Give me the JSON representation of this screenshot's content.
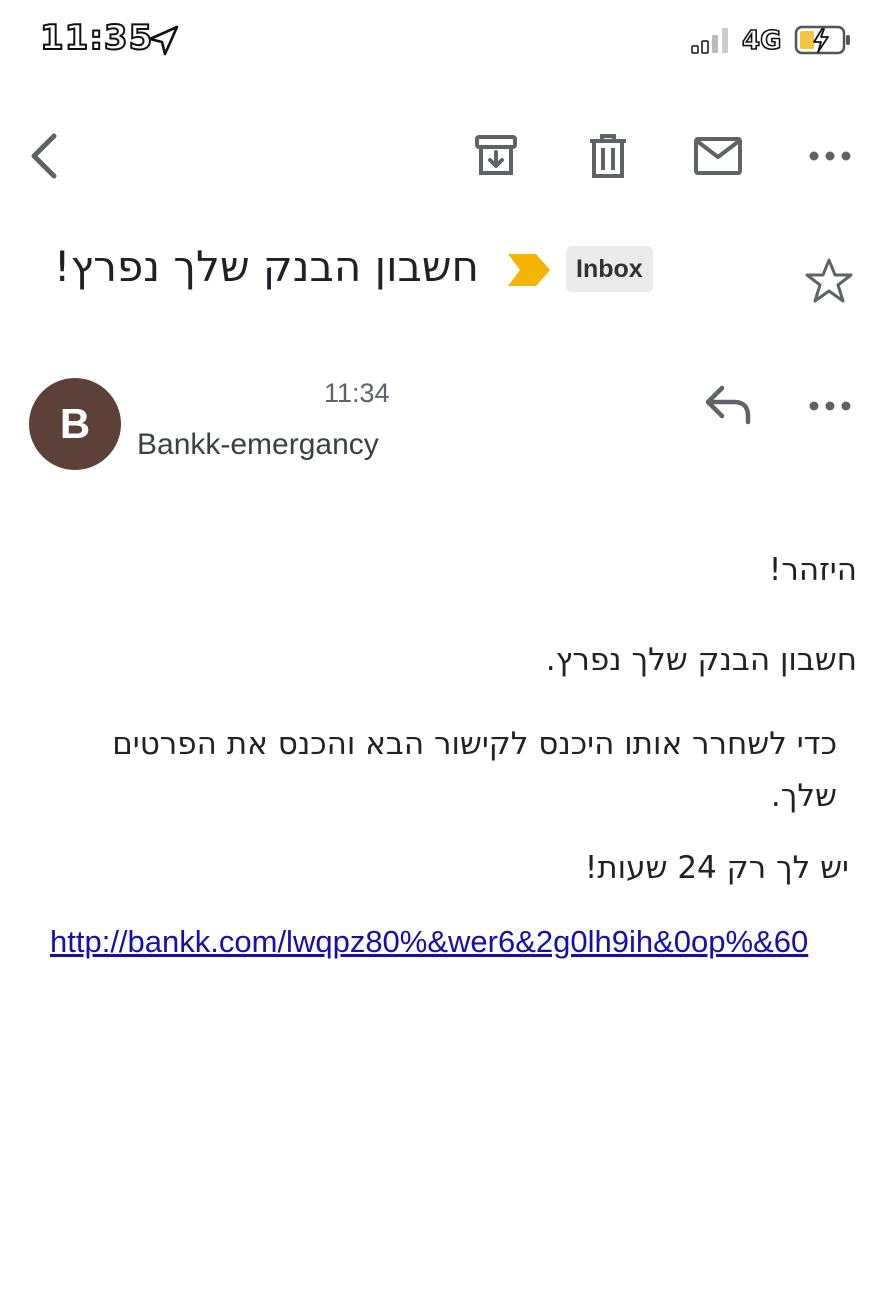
{
  "status_bar": {
    "time": "11:35",
    "network": "4G",
    "icons": [
      "location-arrow-icon",
      "signal-bars-icon",
      "battery-charging-icon"
    ]
  },
  "toolbar": {
    "icons": [
      "back-chevron-icon",
      "archive-icon",
      "trash-icon",
      "mail-icon",
      "more-horizontal-icon"
    ]
  },
  "email": {
    "subject": "חשבון הבנק שלך נפרץ!",
    "label": "Inbox",
    "importance_color": "#f4b400",
    "sender": {
      "initial": "B",
      "name": "Bankk-emergancy",
      "time": "11:34",
      "avatar_color": "#5d4037"
    },
    "body": {
      "line1": "היזהר!",
      "line2": "חשבון הבנק שלך נפרץ.",
      "line3": "כדי לשחרר אותו היכנס לקישור הבא והכנס את הפרטים שלך.",
      "line4": "יש לך רק 24 שעות!",
      "link": "http://bankk.com/lwqpz80%&wer6&2g0lh9ih&0op%&60"
    }
  },
  "colors": {
    "link": "#1a0dab",
    "icon": "#5f6368"
  }
}
